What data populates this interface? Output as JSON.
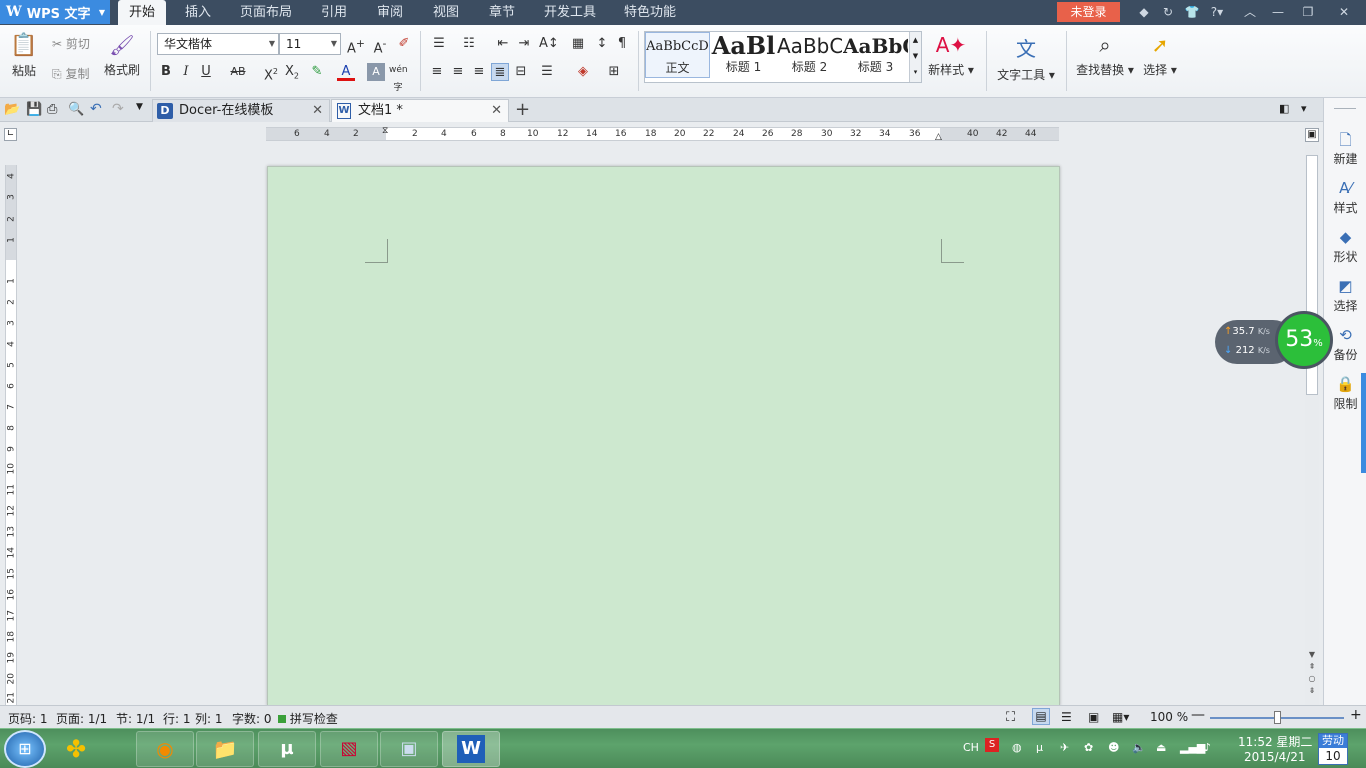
{
  "app": {
    "name": "WPS 文字"
  },
  "menu_tabs": [
    "开始",
    "插入",
    "页面布局",
    "引用",
    "审阅",
    "视图",
    "章节",
    "开发工具",
    "特色功能"
  ],
  "login_label": "未登录",
  "ribbon": {
    "paste": "粘贴",
    "cut": "剪切",
    "copy": "复制",
    "format_painter": "格式刷",
    "font_name": "华文楷体",
    "font_size": "11",
    "styles": [
      {
        "preview": "AaBbCcD",
        "label": "正文"
      },
      {
        "preview": "AaBl",
        "label": "标题 1"
      },
      {
        "preview": "AaBbC",
        "label": "标题 2"
      },
      {
        "preview": "AaBbC",
        "label": "标题 3"
      }
    ],
    "new_style": "新样式",
    "text_tools": "文字工具",
    "find_replace": "查找替换",
    "select": "选择"
  },
  "doc_tabs": [
    {
      "label": "Docer-在线模板",
      "active": false
    },
    {
      "label": "文档1 *",
      "active": true
    }
  ],
  "ruler": {
    "h_ticks": [
      "6",
      "4",
      "2",
      "2",
      "4",
      "6",
      "8",
      "10",
      "12",
      "14",
      "16",
      "18",
      "20",
      "22",
      "24",
      "26",
      "28",
      "30",
      "32",
      "34",
      "36",
      "40",
      "42",
      "44"
    ],
    "v_ticks": [
      "4",
      "3",
      "2",
      "1",
      "1",
      "2",
      "3",
      "4",
      "5",
      "6",
      "7",
      "8",
      "9",
      "10",
      "11",
      "12",
      "13",
      "14",
      "15",
      "16",
      "17",
      "18",
      "19",
      "20",
      "21"
    ]
  },
  "side_panel": [
    "新建",
    "样式",
    "形状",
    "选择",
    "备份",
    "限制"
  ],
  "net_widget": {
    "up": "35.7",
    "down": "212",
    "unit": "K/s",
    "percent": "53",
    "percent_sign": "%"
  },
  "status_bar": {
    "page_code": "页码: 1",
    "page": "页面: 1/1",
    "section": "节: 1/1",
    "row": "行: 1",
    "col": "列: 1",
    "words": "字数: 0",
    "spell": "拼写检查",
    "zoom": "100 %"
  },
  "taskbar": {
    "time": "11:52 星期二",
    "date": "2015/4/21",
    "lang": "CH",
    "labor_day": "劳动",
    "day_num": "10"
  },
  "colors": {
    "accent": "#3b8be0",
    "page_bg": "#cde8cf",
    "login": "#e8614a",
    "net_green": "#2cbf3a"
  }
}
